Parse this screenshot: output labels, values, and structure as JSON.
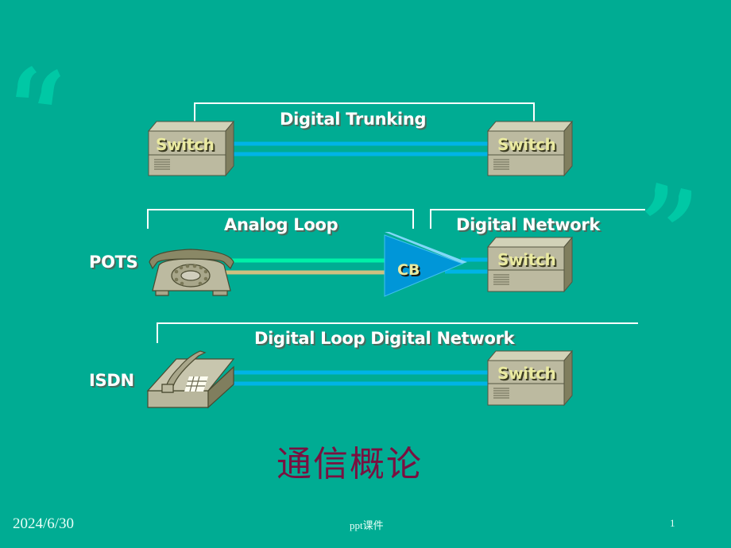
{
  "slide": {
    "labels": {
      "digital_trunking": "Digital Trunking",
      "analog_loop": "Analog Loop",
      "digital_network": "Digital Network",
      "digital_loop_digital_network": "Digital Loop Digital Network",
      "pots": "POTS",
      "isdn": "ISDN",
      "cb": "CB"
    },
    "switches": [
      {
        "label": "Switch"
      },
      {
        "label": "Switch"
      },
      {
        "label": "Switch"
      },
      {
        "label": "Switch"
      }
    ],
    "title": "通信概论",
    "quote_open": "“",
    "quote_close": "”"
  },
  "footer": {
    "date": "2024/6/30",
    "center": "ppt课件",
    "page_number": "1"
  },
  "colors": {
    "background": "#00ac93",
    "digital_line": "#00b4e6",
    "analog_line_green": "#00f0a8",
    "analog_line_tan": "#d0c080",
    "bracket": "#ffffff",
    "title": "#7a1040",
    "cb_blue": "#0090d8"
  }
}
